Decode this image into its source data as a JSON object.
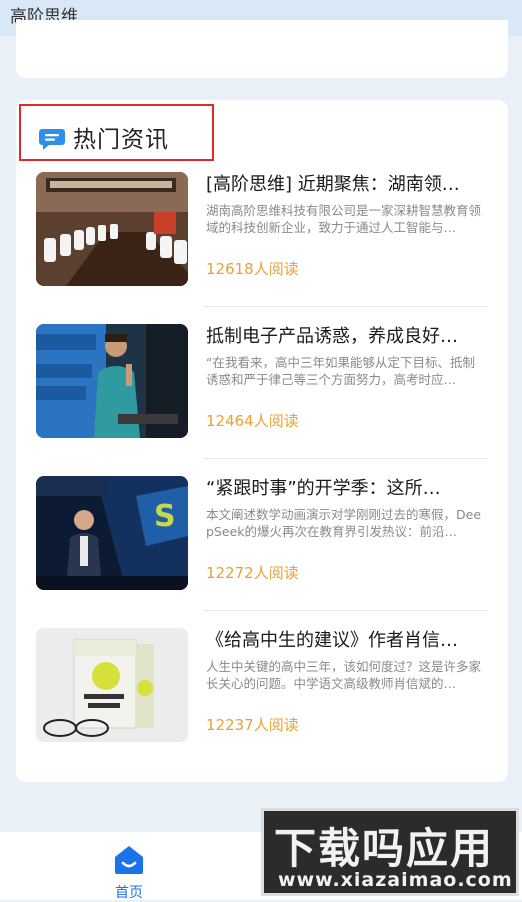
{
  "app": {
    "title": "高阶思维"
  },
  "section": {
    "title": "热门资讯"
  },
  "news": [
    {
      "title": "[高阶思维] 近期聚焦：湖南领…",
      "summary": "湖南高阶思维科技有限公司是一家深耕智慧教育领域的科技创新企业，致力于通过人工智能与…",
      "reads": "12618人阅读",
      "thumb_icon": "meeting-room-photo"
    },
    {
      "title": "抵制电子产品诱惑，养成良好…",
      "summary": "“在我看来，高中三年如果能够从定下目标、抵制诱惑和严于律己等三个方面努力，高考时应…",
      "reads": "12464人阅读",
      "thumb_icon": "speaker-photo"
    },
    {
      "title": "“紧跟时事”的开学季：这所…",
      "summary": "本文阐述数学动画演示对学刚刚过去的寒假，DeepSeek的爆火再次在教育界引发热议：前沿…",
      "reads": "12272人阅读",
      "thumb_icon": "stage-speaker-photo"
    },
    {
      "title": "《给高中生的建议》作者肖信…",
      "summary": "人生中关键的高中三年，该如何度过？这是许多家长关心的问题。中学语文高级教师肖信斌的…",
      "reads": "12237人阅读",
      "thumb_icon": "book-cover-photo"
    }
  ],
  "tabbar": {
    "home_label": "首页"
  },
  "watermark": {
    "main": "下载吗应用",
    "url": "www.xiazaimao.com"
  },
  "colors": {
    "accent": "#1a73e8",
    "reads": "#e8a132",
    "highlight_border": "#e02a2a"
  }
}
